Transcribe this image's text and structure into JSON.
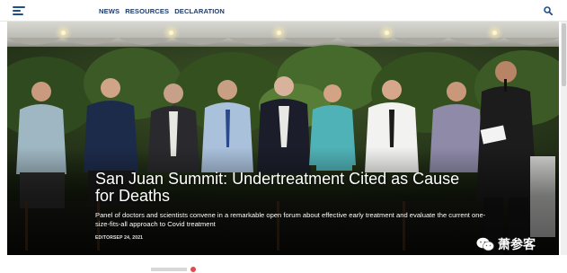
{
  "header": {
    "nav": [
      "NEWS",
      "RESOURCES",
      "DECLARATION"
    ],
    "menu_icon": "hamburger-menu-icon",
    "search_icon": "search-icon"
  },
  "hero": {
    "headline": "San Juan Summit: Undertreatment Cited as Cause for Deaths",
    "subtitle": "Panel of doctors and scientists convene in a remarkable open forum about effective early treatment and evaluate the current one-size-fits-all approach to Covid treatment",
    "byline": "EDITORSEP 24, 2021"
  },
  "watermark": {
    "text": "萧参客",
    "icon": "wechat-icon"
  },
  "colors": {
    "nav_text": "#1c3b6b",
    "accent": "#1d4f8c",
    "headline_text": "#ffffff"
  }
}
